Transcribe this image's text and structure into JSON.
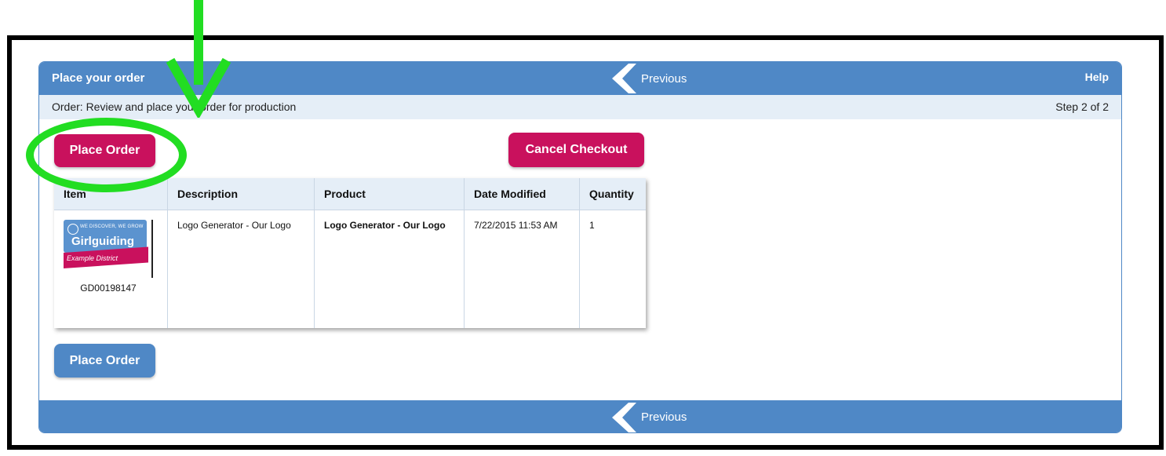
{
  "header": {
    "title": "Place your order",
    "previous_label": "Previous",
    "help_label": "Help"
  },
  "subheader": {
    "text": "Order: Review and place your order for production",
    "step": "Step 2 of 2"
  },
  "actions": {
    "place_order": "Place Order",
    "cancel_checkout": "Cancel Checkout",
    "place_order_bottom": "Place Order"
  },
  "table": {
    "columns": [
      "Item",
      "Description",
      "Product",
      "Date Modified",
      "Quantity"
    ],
    "rows": [
      {
        "item_code": "GD00198147",
        "thumbnail": {
          "tagline": "WE DISCOVER, WE GROW",
          "brand": "Girlguiding",
          "district": "Example District"
        },
        "description": "Logo Generator - Our Logo",
        "product": "Logo Generator - Our Logo",
        "date_modified": "7/22/2015 11:53 AM",
        "quantity": "1"
      }
    ]
  },
  "footer": {
    "previous_label": "Previous"
  },
  "colors": {
    "accent_blue": "#4f88c6",
    "accent_red": "#c9115d",
    "annotation_green": "#22dd22"
  }
}
